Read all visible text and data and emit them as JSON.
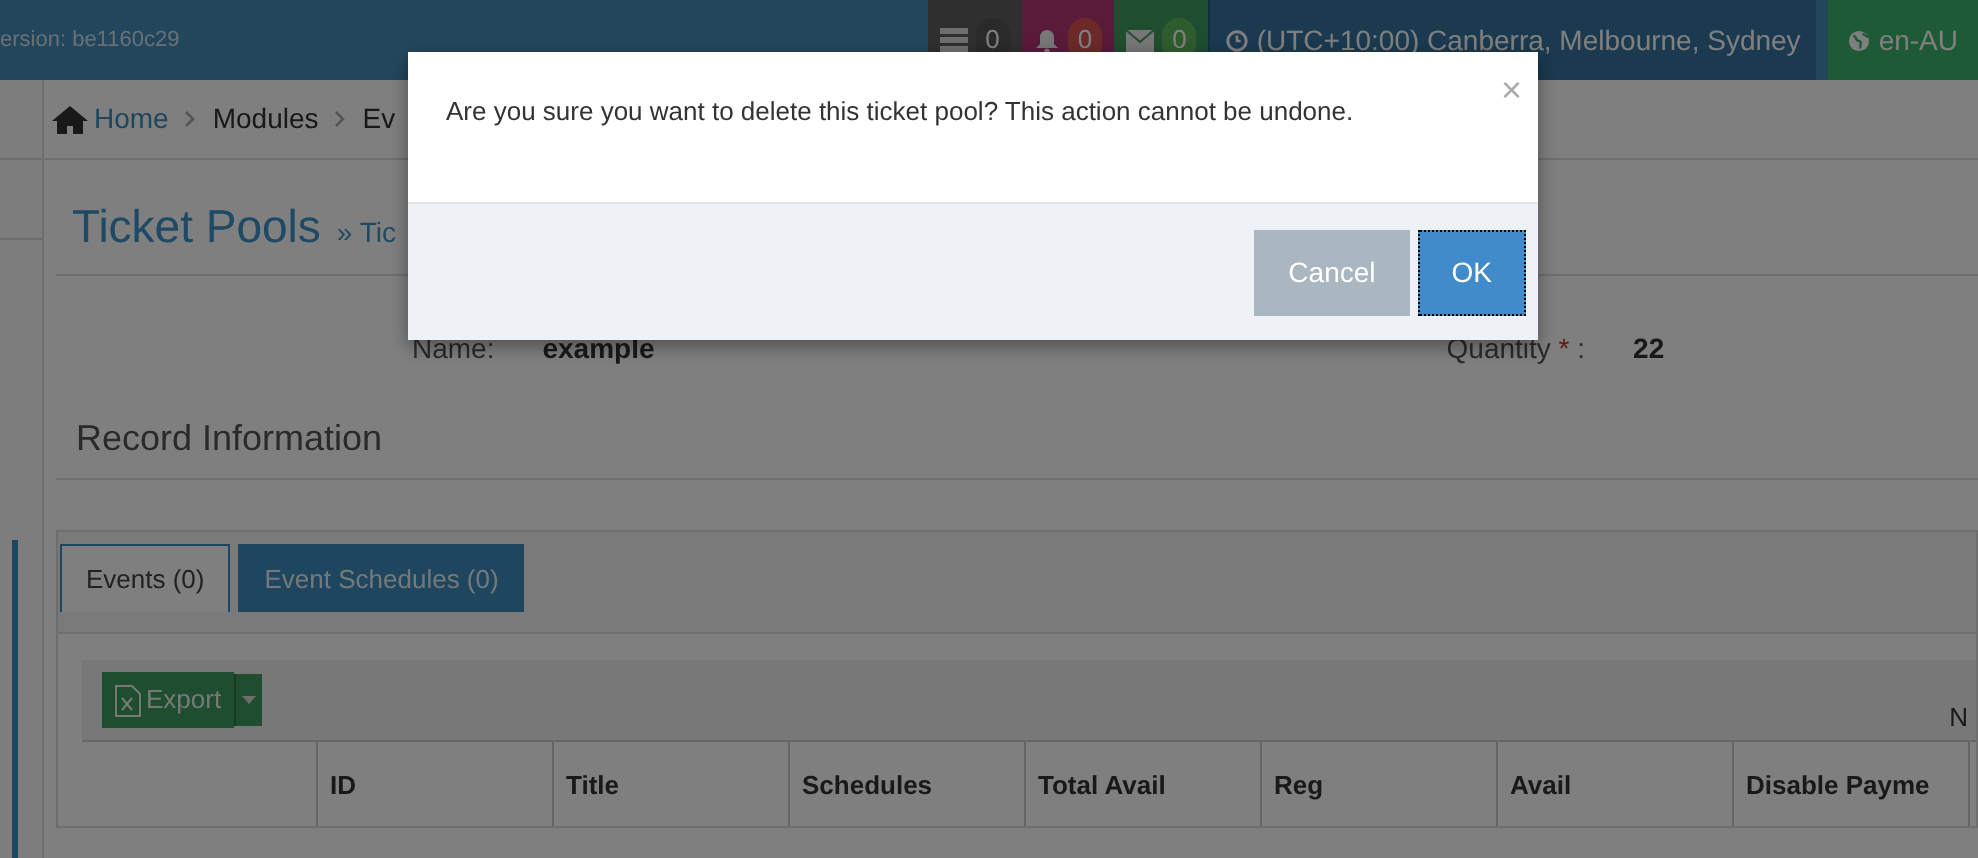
{
  "top_bar": {
    "version": "ersion: be1160c29",
    "badges": [
      {
        "kind": "tasks",
        "count": "0"
      },
      {
        "kind": "notifications",
        "count": "0"
      },
      {
        "kind": "messages",
        "count": "0"
      }
    ],
    "timezone": "(UTC+10:00) Canberra, Melbourne, Sydney",
    "language": "en-AU"
  },
  "breadcrumb": [
    "Home",
    "Modules",
    "Ev"
  ],
  "page_title": "Ticket Pools",
  "subtitle": "» Tic",
  "fields": [
    {
      "label": "Name:",
      "value": "example",
      "required": false
    },
    {
      "label": "Quantity",
      "value": "22",
      "required": true,
      "required_mark": "*",
      "suffix": ":"
    }
  ],
  "section_title": "Record Information",
  "tabs": [
    {
      "label": "Events (0)",
      "selected": true
    },
    {
      "label": "Event Schedules (0)",
      "selected": false
    }
  ],
  "toolbar": {
    "export": "Export",
    "right_text": "N"
  },
  "table": {
    "columns": [
      "ID",
      "Title",
      "Schedules",
      "Total Avail",
      "Reg",
      "Avail",
      "Disable Payme"
    ]
  },
  "dialog": {
    "message": "Are you sure you want to delete this ticket pool? This action cannot be undone.",
    "close": "×",
    "buttons": [
      {
        "label": "Cancel",
        "kind": "secondary",
        "focused": false
      },
      {
        "label": "OK",
        "kind": "primary",
        "focused": true
      }
    ]
  }
}
